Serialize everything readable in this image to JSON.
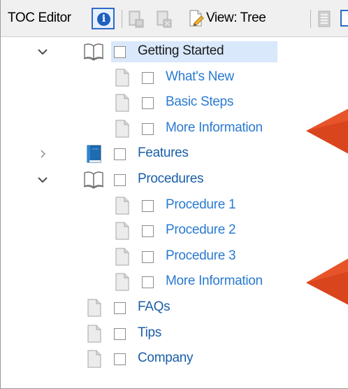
{
  "toolbar": {
    "title": "TOC Editor",
    "info_icon": "info-icon",
    "view_label": "View: Tree",
    "disabled_icons": [
      "book-properties-icon",
      "book-add-icon",
      "book-layout-icon"
    ]
  },
  "tree": {
    "items": [
      {
        "label": "Getting Started",
        "level": 0,
        "type": "book-open",
        "expander": "expanded",
        "selected": true
      },
      {
        "label": "What's New",
        "level": 1,
        "type": "page",
        "expander": "none"
      },
      {
        "label": "Basic Steps",
        "level": 1,
        "type": "page",
        "expander": "none"
      },
      {
        "label": "More Information",
        "level": 1,
        "type": "page",
        "expander": "none",
        "callout": true
      },
      {
        "label": "Features",
        "level": 0,
        "type": "book-closed",
        "expander": "collapsed"
      },
      {
        "label": "Procedures",
        "level": 0,
        "type": "book-open",
        "expander": "expanded"
      },
      {
        "label": "Procedure 1",
        "level": 1,
        "type": "page",
        "expander": "none"
      },
      {
        "label": "Procedure 2",
        "level": 1,
        "type": "page",
        "expander": "none"
      },
      {
        "label": "Procedure 3",
        "level": 1,
        "type": "page",
        "expander": "none"
      },
      {
        "label": "More Information",
        "level": 1,
        "type": "page",
        "expander": "none",
        "callout": true
      },
      {
        "label": "FAQs",
        "level": 0,
        "type": "page",
        "expander": "none"
      },
      {
        "label": "Tips",
        "level": 0,
        "type": "page",
        "expander": "none"
      },
      {
        "label": "Company",
        "level": 0,
        "type": "page",
        "expander": "none"
      }
    ]
  },
  "colors": {
    "link": "#2a7ad0",
    "selection": "#d9e8fb",
    "callout_arrow": "#e8542a"
  }
}
